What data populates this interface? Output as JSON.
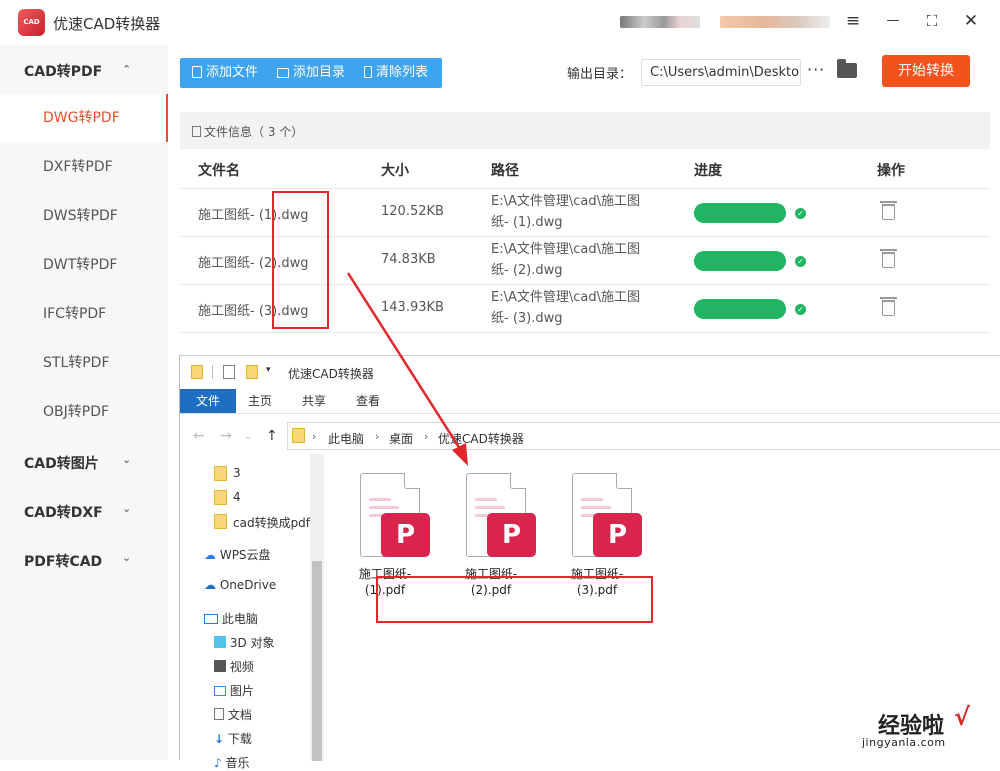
{
  "app": {
    "logo_text": "CAD",
    "title": "优速CAD转换器"
  },
  "window_controls": {
    "menu": "≡",
    "minimize": "—",
    "maximize": "⛶",
    "close": "✕"
  },
  "sidebar": {
    "groups": [
      {
        "label": "CAD转PDF",
        "chevron": "⌃"
      },
      {
        "label": "CAD转图片",
        "chevron": "⌄"
      },
      {
        "label": "CAD转DXF",
        "chevron": "⌄"
      },
      {
        "label": "PDF转CAD",
        "chevron": "⌄"
      }
    ],
    "items": [
      {
        "label": "DWG转PDF",
        "active": true
      },
      {
        "label": "DXF转PDF"
      },
      {
        "label": "DWS转PDF"
      },
      {
        "label": "DWT转PDF"
      },
      {
        "label": "IFC转PDF"
      },
      {
        "label": "STL转PDF"
      },
      {
        "label": "OBJ转PDF"
      }
    ]
  },
  "toolbar": {
    "add_file": "添加文件",
    "add_dir": "添加目录",
    "clear_list": "清除列表",
    "output_label": "输出目录：",
    "output_value": "C:\\Users\\admin\\Desktop",
    "more": "···",
    "start": "开始转换"
  },
  "file_info": {
    "label": "文件信息",
    "count": "（ 3 个）"
  },
  "table": {
    "headers": {
      "name": "文件名",
      "size": "大小",
      "path": "路径",
      "progress": "进度",
      "action": "操作"
    },
    "rows": [
      {
        "name": "施工图纸- (1).dwg",
        "size": "120.52KB",
        "path_1": "E:\\A文件管理\\cad\\施工图",
        "path_2": "纸- (1).dwg",
        "progress": 1.0
      },
      {
        "name": "施工图纸- (2).dwg",
        "size": "74.83KB",
        "path_1": "E:\\A文件管理\\cad\\施工图",
        "path_2": "纸- (2).dwg",
        "progress": 1.0
      },
      {
        "name": "施工图纸- (3).dwg",
        "size": "143.93KB",
        "path_1": "E:\\A文件管理\\cad\\施工图",
        "path_2": "纸- (3).dwg",
        "progress": 1.0
      }
    ]
  },
  "explorer": {
    "title": "优速CAD转换器",
    "ribbon": [
      "文件",
      "主页",
      "共享",
      "查看"
    ],
    "breadcrumb": [
      "此电脑",
      "桌面",
      "优速CAD转换器"
    ],
    "tree": [
      {
        "label": "3",
        "icon": "folder"
      },
      {
        "label": "4",
        "icon": "folder"
      },
      {
        "label": "cad转换成pdf",
        "icon": "folder"
      },
      {
        "label": "WPS云盘",
        "icon": "cloud"
      },
      {
        "label": "OneDrive",
        "icon": "cloud"
      },
      {
        "label": "此电脑",
        "icon": "computer"
      },
      {
        "label": "3D 对象",
        "icon": "cube"
      },
      {
        "label": "视频",
        "icon": "video"
      },
      {
        "label": "图片",
        "icon": "picture"
      },
      {
        "label": "文档",
        "icon": "document"
      },
      {
        "label": "下载",
        "icon": "download"
      },
      {
        "label": "音乐",
        "icon": "music"
      }
    ],
    "files": [
      {
        "line1": "施工图纸-",
        "line2": "(1).pdf"
      },
      {
        "line1": "施工图纸-",
        "line2": "(2).pdf"
      },
      {
        "line1": "施工图纸-",
        "line2": "(3).pdf"
      }
    ]
  },
  "watermark": {
    "cn": "经验啦",
    "check": "√",
    "en": "jingyanla.com"
  },
  "colors": {
    "accent": "#e8502a",
    "primary_blue": "#3ea4ef",
    "start_button": "#f2521c",
    "progress": "#21b563",
    "annotation": "#e3262a",
    "pdf_badge": "#d9254e"
  }
}
